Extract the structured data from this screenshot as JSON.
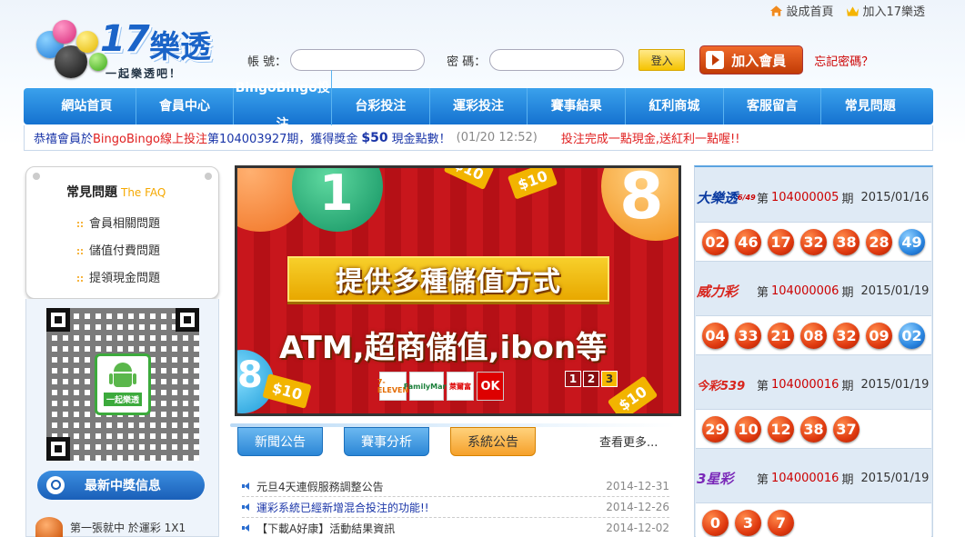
{
  "toplinks": {
    "home": "設成首頁",
    "add": "加入17樂透"
  },
  "logo": {
    "num": "17",
    "name": "樂透",
    "slogan": "一起樂透吧！"
  },
  "login": {
    "user_label": "帳 號：",
    "pass_label": "密 碼：",
    "login_button": "登入",
    "join_button": "加入會員",
    "forgot": "忘記密碼？"
  },
  "nav": [
    "網站首頁",
    "會員中心",
    "BingoBingo投注",
    "台彩投注",
    "運彩投注",
    "賽事結果",
    "紅利商城",
    "客服留言",
    "常見問題"
  ],
  "ticker": {
    "p1": "恭禧會員於",
    "game": "BingoBingo線上投注",
    "p2": "第104003927期，獲得獎金",
    "amount": "$50",
    "p3": "現金點數！",
    "time": "(01/20 12:52)",
    "promo": "投注完成一點現金,送紅利一點喔!!"
  },
  "faq": {
    "title": "常見問題",
    "title_en": "The FAQ",
    "items": [
      "會員相關問題",
      "儲值付費問題",
      "提領現金問題"
    ]
  },
  "qr": {
    "android_label": "一起樂透"
  },
  "winners": {
    "button": "最新中獎信息",
    "item": "第一張就中 於運彩 1X1"
  },
  "banner": {
    "headline": "提供多種儲值方式",
    "subline": "ATM,超商儲值,ibon等",
    "stores": [
      "7-ELEVEN",
      "FamilyMart",
      "萊爾富",
      "OK"
    ],
    "tags": [
      "$10",
      "$10",
      "$10",
      "$10"
    ],
    "numbers": [
      "1",
      "8",
      "8"
    ],
    "pages": [
      "1",
      "2",
      "3"
    ]
  },
  "tabs": {
    "items": [
      "新聞公告",
      "賽事分析",
      "系統公告"
    ],
    "more": "查看更多..."
  },
  "news": [
    {
      "title": "元旦4天連假服務調整公告",
      "date": "2014-12-31",
      "highlight": false
    },
    {
      "title": "運彩系統已經新增混合投注的功能!!",
      "date": "2014-12-26",
      "highlight": true
    },
    {
      "title": "【下載A好康】活動結果資訊",
      "date": "2014-12-02",
      "highlight": false
    }
  ],
  "lotto": [
    {
      "name": "大樂透",
      "tag": "6/49",
      "prefix": "第",
      "period": "104000005",
      "suffix": "期",
      "date": "2015/01/16",
      "balls": [
        "02",
        "46",
        "17",
        "32",
        "38",
        "28"
      ],
      "special": "49"
    },
    {
      "name": "威力彩",
      "tag": "",
      "prefix": "第",
      "period": "104000006",
      "suffix": "期",
      "date": "2015/01/19",
      "balls": [
        "04",
        "33",
        "21",
        "08",
        "32",
        "09"
      ],
      "special": "02"
    },
    {
      "name": "今彩539",
      "tag": "",
      "prefix": "第",
      "period": "104000016",
      "suffix": "期",
      "date": "2015/01/19",
      "balls": [
        "29",
        "10",
        "12",
        "38",
        "37"
      ],
      "special": ""
    },
    {
      "name": "3星彩",
      "tag": "",
      "prefix": "第",
      "period": "104000016",
      "suffix": "期",
      "date": "2015/01/19",
      "balls": [
        "0",
        "3",
        "7"
      ],
      "special": ""
    }
  ],
  "colors": {
    "nav": "#1f82dc",
    "accent_orange": "#e04a10",
    "ball_red": "#e03a10",
    "ball_blue": "#2a86e0"
  }
}
